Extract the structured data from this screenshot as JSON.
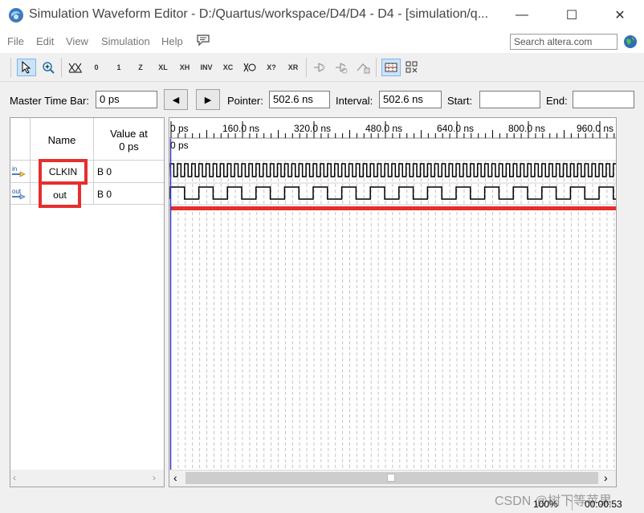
{
  "window": {
    "title": "Simulation Waveform Editor - D:/Quartus/workspace/D4/D4 - D4 - [simulation/q...",
    "minimize_glyph": "—",
    "maximize_glyph": "☐",
    "close_glyph": "✕"
  },
  "menu": {
    "items": [
      "File",
      "Edit",
      "View",
      "Simulation",
      "Help"
    ],
    "search_value": "Search altera.com"
  },
  "toolbar": {
    "icons": [
      "selection-tool-icon",
      "zoom-tool-icon",
      "force-unknown-icon",
      "force-low-icon",
      "force-high-icon",
      "force-high-impedance-icon",
      "force-weak-low-icon",
      "force-weak-high-icon",
      "invert-icon",
      "count-value-icon",
      "clock-icon",
      "random-values-icon",
      "overwrite-values-icon",
      "run-functional-simulation-icon",
      "run-timing-simulation-icon",
      "generate-netlist-icon",
      "snap-to-grid-icon",
      "grid-settings-icon"
    ],
    "labels": {
      "zero": "0",
      "one": "1",
      "z": "Z",
      "xl": "XL",
      "xh": "XH",
      "inv": "INV",
      "xc": "XC",
      "q2": "X?",
      "xr": "XR"
    }
  },
  "timebar": {
    "master_label": "Master Time Bar:",
    "master_value": "0 ps",
    "prev": "◀",
    "next": "▶",
    "pointer_label": "Pointer:",
    "pointer_value": "502.6 ns",
    "interval_label": "Interval:",
    "interval_value": "502.6 ns",
    "start_label": "Start:",
    "start_value": "",
    "end_label": "End:",
    "end_value": ""
  },
  "signals": {
    "col_name": "Name",
    "col_value_line1": "Value at",
    "col_value_line2": "0 ps",
    "rows": [
      {
        "dir": "in",
        "name": "CLKIN",
        "value": "B 0"
      },
      {
        "dir": "out",
        "name": "out",
        "value": "B 0"
      }
    ]
  },
  "waveform": {
    "time_labels": [
      "0 ps",
      "160.0 ns",
      "320.0 ns",
      "480.0 ns",
      "640.0 ns",
      "800.0 ns",
      "960.0 ns"
    ],
    "cursor_label": "0 ps"
  },
  "status": {
    "zoom": "100%",
    "elapsed": "00:00:53"
  },
  "watermark": "CSDN @树下等苹果",
  "colors": {
    "highlight_red": "#e62e2e",
    "cursor_blue": "#3333cc"
  }
}
